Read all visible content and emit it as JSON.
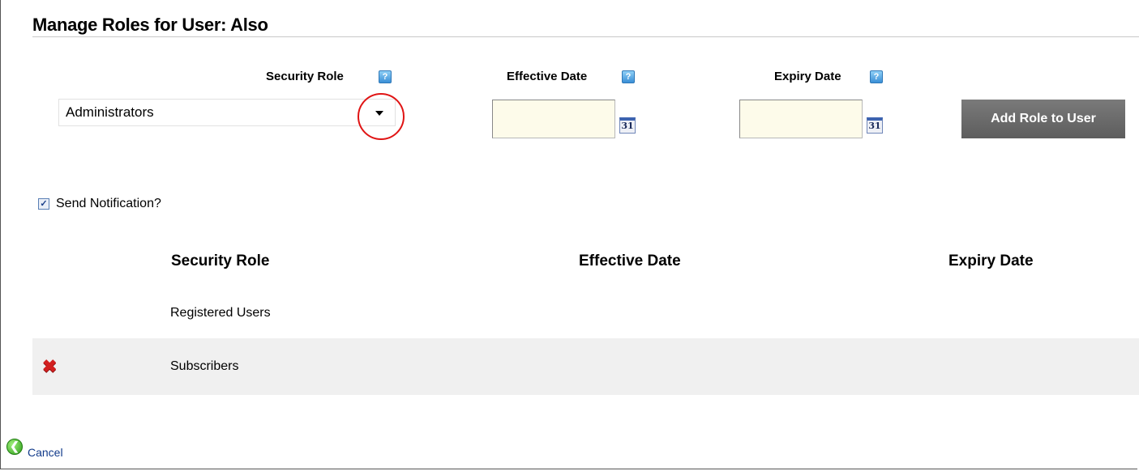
{
  "page": {
    "title": "Manage Roles for User: Also"
  },
  "form": {
    "security_role_label": "Security Role",
    "effective_date_label": "Effective Date",
    "expiry_date_label": "Expiry Date",
    "help_icon": "?",
    "selected_role": "Administrators",
    "effective_date_value": "",
    "expiry_date_value": "",
    "calendar_icon_text": "31",
    "add_button_label": "Add Role to User",
    "send_notification_label": "Send Notification?",
    "send_notification_checked": true,
    "checkmark": "✓"
  },
  "table": {
    "columns": [
      "Security Role",
      "Effective Date",
      "Expiry Date"
    ],
    "rows": [
      {
        "role": "Registered Users",
        "effective": "",
        "expiry": "",
        "deletable": false
      },
      {
        "role": "Subscribers",
        "effective": "",
        "expiry": "",
        "deletable": true
      }
    ],
    "delete_icon": "✖"
  },
  "footer": {
    "cancel_label": "Cancel",
    "cancel_icon": "❮"
  },
  "colors": {
    "accent_input": "#fdfbea",
    "button_bg": "#6a6a6a",
    "highlight_circle": "#e01414",
    "row_alt": "#f0f0f0"
  }
}
